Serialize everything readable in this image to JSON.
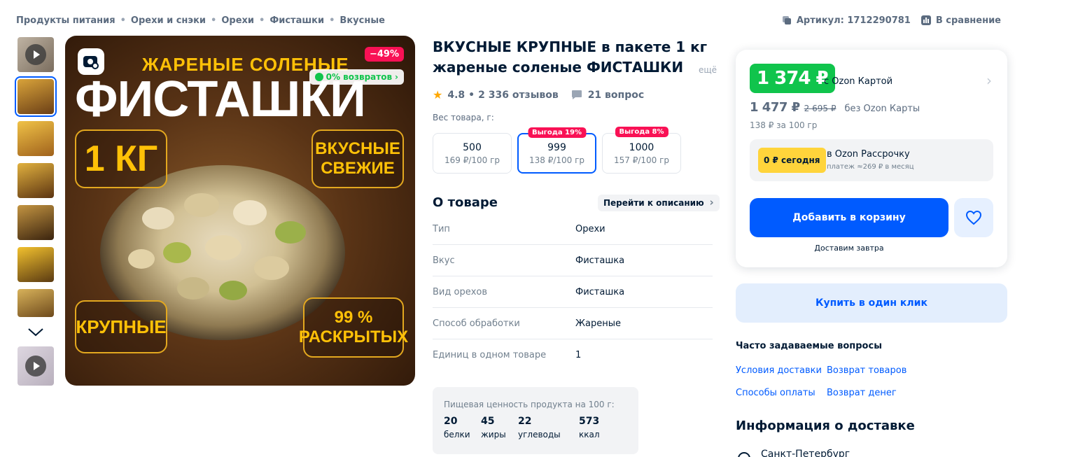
{
  "breadcrumb": [
    "Продукты питания",
    "Орехи и снэки",
    "Орехи",
    "Фисташки",
    "Вкусные"
  ],
  "header_right": {
    "sku_label": "Артикул: 1712290781",
    "compare_label": "В сравнение"
  },
  "gallery": {
    "image_top_text": "ЖАРЕНЫЕ СОЛЕНЫЕ",
    "image_title": "ФИСТАШКИ",
    "box_weight": "1 КГ",
    "box_fresh": "ВКУСНЫЕ СВЕЖИЕ",
    "box_big": "КРУПНЫЕ",
    "box_open": "99 % РАСКРЫТЫХ",
    "discount_badge": "−49%",
    "returns_badge": "0% возвратов"
  },
  "product": {
    "title": "ВКУСНЫЕ КРУПНЫЕ в пакете 1 кг жареные соленые ФИСТАШКИ",
    "title_more": "ещё",
    "rating": "4.8",
    "reviews": "2 336 отзывов",
    "questions": "21 вопрос"
  },
  "weight": {
    "label": "Вес товара, г:",
    "options": [
      {
        "value": "500",
        "price": "169 ₽/100 гр",
        "badge": ""
      },
      {
        "value": "999",
        "price": "138 ₽/100 гр",
        "badge": "Выгода 19%"
      },
      {
        "value": "1000",
        "price": "157 ₽/100 гр",
        "badge": "Выгода 8%"
      }
    ]
  },
  "about": {
    "title": "О товаре",
    "link": "Перейти к описанию",
    "specs": [
      {
        "key": "Тип",
        "value": "Орехи"
      },
      {
        "key": "Вкус",
        "value": "Фисташка"
      },
      {
        "key": "Вид орехов",
        "value": "Фисташка"
      },
      {
        "key": "Способ обработки",
        "value": "Жареные"
      },
      {
        "key": "Единиц в одном товаре",
        "value": "1"
      }
    ]
  },
  "nutrition": {
    "label": "Пищевая ценность продукта на 100 г:",
    "items": [
      {
        "value": "20",
        "unit": "белки"
      },
      {
        "value": "45",
        "unit": "жиры"
      },
      {
        "value": "22",
        "unit": "углеводы"
      },
      {
        "value": "573",
        "unit": "ккал"
      }
    ]
  },
  "price": {
    "card_price": "1 374 ₽",
    "card_label": "с Ozon Картой",
    "regular_price": "1 477 ₽",
    "old_price": "2 695 ₽",
    "regular_label": "без Ozon Карты",
    "per_unit": "138 ₽ за 100 гр",
    "installment_today": "0 ₽ сегодня",
    "installment_title": "в Ozon Рассрочку",
    "installment_sub": "платеж ≈269 ₽ в месяц",
    "add_to_cart": "Добавить в корзину",
    "delivery_note": "Доставим завтра",
    "buy_one_click": "Купить в один клик"
  },
  "faq": {
    "title": "Часто задаваемые вопросы",
    "links": [
      "Условия доставки",
      "Возврат товаров",
      "Способы оплаты",
      "Возврат денег"
    ]
  },
  "delivery": {
    "title": "Информация о доставке",
    "city": "Санкт-Петербург"
  },
  "colors": {
    "accent": "#005bff",
    "card_price_green": "#10c44c",
    "discount_red": "#f91155",
    "installment_yellow": "#ffd43b"
  }
}
